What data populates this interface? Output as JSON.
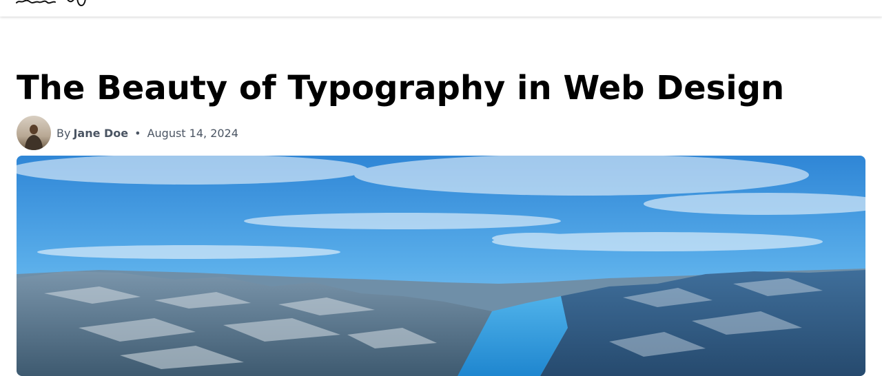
{
  "header": {
    "logo_icon": "handwritten-logo-icon"
  },
  "article": {
    "title": "The Beauty of Typography in Web Design",
    "byline": {
      "prefix": "By",
      "author": "Jane Doe",
      "separator": "•",
      "date": "August 14, 2024",
      "avatar_icon": "author-avatar"
    },
    "hero_image": "fjord-landscape-photo"
  },
  "colors": {
    "title": "#000000",
    "meta_text": "#4b5563",
    "sky": "#3b95dc",
    "water": "#2f9fe0"
  }
}
